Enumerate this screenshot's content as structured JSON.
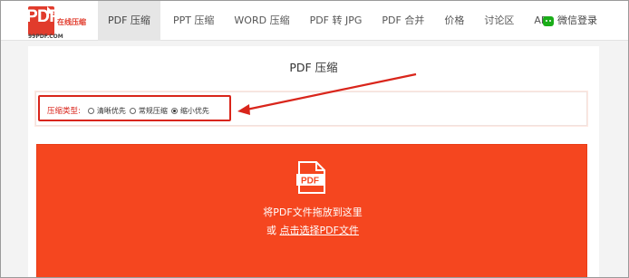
{
  "logo": {
    "mark": "PDF",
    "cn_name": "在线压缩",
    "domain": "99PDF.COM"
  },
  "nav": {
    "items": [
      {
        "label": "PDF 压缩",
        "active": true
      },
      {
        "label": "PPT 压缩",
        "active": false
      },
      {
        "label": "WORD 压缩",
        "active": false
      },
      {
        "label": "PDF 转 JPG",
        "active": false
      },
      {
        "label": "PDF 合并",
        "active": false
      },
      {
        "label": "价格",
        "active": false
      },
      {
        "label": "讨论区",
        "active": false
      },
      {
        "label": "API",
        "active": false
      }
    ],
    "login_label": "微信登录"
  },
  "page": {
    "title": "PDF 压缩"
  },
  "compression": {
    "label": "压缩类型:",
    "options": [
      {
        "label": "清晰优先",
        "selected": false
      },
      {
        "label": "常规压缩",
        "selected": false
      },
      {
        "label": "缩小优先",
        "selected": true
      }
    ]
  },
  "upload": {
    "icon_text": "PDF",
    "line1": "将PDF文件拖放到这里",
    "line2_prefix": "或",
    "line2_link": "点击选择PDF文件"
  },
  "colors": {
    "accent": "#f5461f",
    "annotation": "#d9251b",
    "wechat": "#1aad19"
  },
  "icons": [
    "pdf-logo-icon",
    "wechat-icon",
    "pdf-file-icon",
    "annotation-arrow-icon"
  ]
}
